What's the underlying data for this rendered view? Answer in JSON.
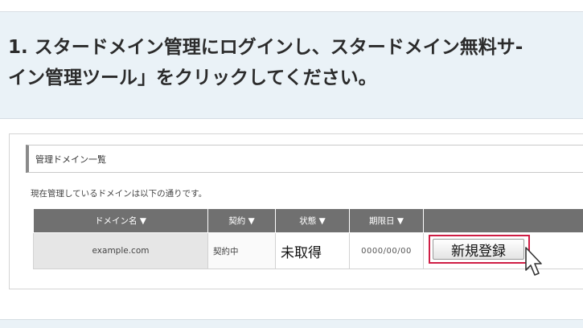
{
  "step": {
    "line1": "1. スタードメイン管理にログインし、スタードメイン無料サ-",
    "line2": "イン管理ツール」をクリックしてください。"
  },
  "panel": {
    "title": "管理ドメイン一覧",
    "description": "現在管理しているドメインは以下の通りです。"
  },
  "table": {
    "headers": [
      "ドメイン名 ▼",
      "契約 ▼",
      "状態 ▼",
      "期限日 ▼",
      ""
    ],
    "row": {
      "domain": "example.com",
      "contract": "契約中",
      "status": "未取得",
      "expire": "0000/00/00",
      "action_label": "新規登録"
    }
  },
  "colors": {
    "highlight": "#cf1e45",
    "header_bg": "#707070",
    "step_bg": "#eaf2f7"
  },
  "icons": [
    "mouse-pointer-icon"
  ]
}
